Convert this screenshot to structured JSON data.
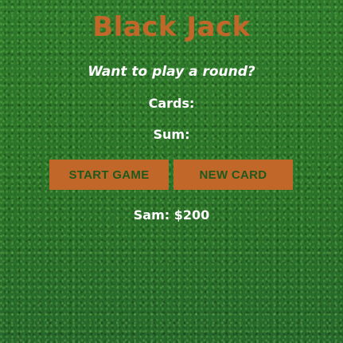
{
  "game": {
    "title": "Black Jack",
    "message": "Want to play a round?",
    "cards_label": "Cards:",
    "sum_label": "Sum:",
    "player_info": "Sam: $200"
  },
  "buttons": {
    "start_game": "START GAME",
    "new_card": "NEW CARD"
  },
  "colors": {
    "accent": "#c2672a",
    "text": "#ffffff",
    "button_text": "#1f5a1d",
    "background": "#2f7d2c"
  }
}
